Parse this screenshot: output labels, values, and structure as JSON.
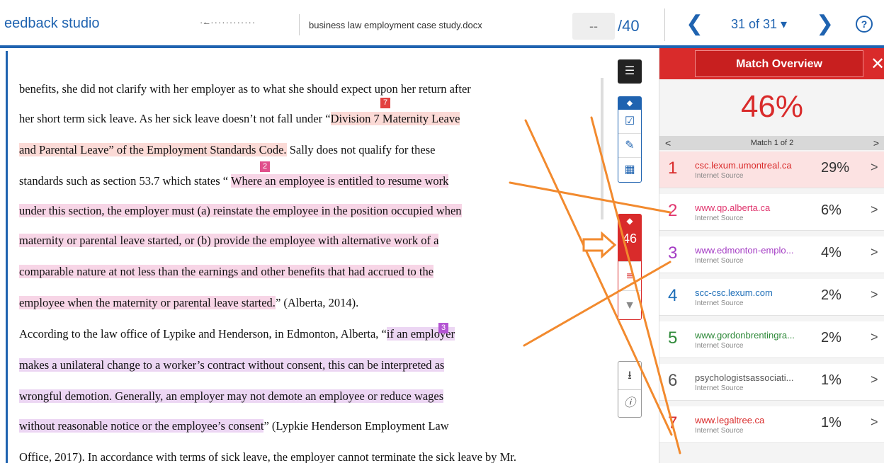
{
  "header": {
    "brand": "eedback studio",
    "student": "··̶ ············",
    "document": "business law employment case study.docx",
    "grade_value": "--",
    "grade_total": "/40",
    "paper_count": "31 of 31 ▾",
    "help": "?"
  },
  "doc": {
    "lines": [
      [
        {
          "t": "benefits, she did not clarify with her employer as to what she should expect upon her return after",
          "h": ""
        }
      ],
      [
        {
          "t": "her short term sick leave.  As her sick leave doesn’t not fall under “",
          "h": ""
        },
        {
          "t": "Division 7 Maternity Leave",
          "h": "red"
        }
      ],
      [
        {
          "t": "and Parental Leave” of  the Employment Standards Code.",
          "h": "red"
        },
        {
          "t": " Sally does not qualify for these",
          "h": ""
        }
      ],
      [
        {
          "t": "standards such as section 53.7 which states “ ",
          "h": ""
        },
        {
          "t": "Where an employee is entitled to resume work",
          "h": "pink"
        }
      ],
      [
        {
          "t": "under this section, the employer must (a) reinstate the employee in the position occupied when",
          "h": "pink"
        }
      ],
      [
        {
          "t": "maternity or parental leave started, or (b) provide the employee with alternative work of a",
          "h": "pink"
        }
      ],
      [
        {
          "t": "comparable nature at not less than the earnings and other benefits that had accrued to the",
          "h": "pink"
        }
      ],
      [
        {
          "t": "employee when the maternity or parental leave started.",
          "h": "pink"
        },
        {
          "t": "” (Alberta, 2014).",
          "h": ""
        }
      ],
      [
        {
          "t": "According to the law office of Lypike and Henderson, in Edmonton, Alberta, “",
          "h": ""
        },
        {
          "t": "if an employer",
          "h": "purple"
        }
      ],
      [
        {
          "t": "makes a unilateral change to a worker’s contract without consent, this can be interpreted as",
          "h": "purple"
        }
      ],
      [
        {
          "t": "wrongful demotion. Generally, an employer may not demote an employee or reduce wages",
          "h": "purple"
        }
      ],
      [
        {
          "t": "without reasonable notice or the employee’s consent",
          "h": "purple"
        },
        {
          "t": "” (Lypkie Henderson Employment Law",
          "h": ""
        }
      ],
      [
        {
          "t": "Office, 2017). In accordance with terms of sick leave, the employer cannot terminate the sick leave by Mr.",
          "h": ""
        }
      ]
    ],
    "badges": {
      "b7": "7",
      "b2": "2",
      "b3": "3"
    }
  },
  "tools": {
    "layers_icon": "layers-icon",
    "red_count": "46"
  },
  "panel": {
    "title": "Match Overview",
    "percent": "46%",
    "match_nav": "Match 1 of 2",
    "matches": [
      {
        "num": "1",
        "source": "csc.lexum.umontreal.ca",
        "type": "Internet Source",
        "pct": "29%",
        "color": "#d92b2b"
      },
      {
        "num": "2",
        "source": "www.qp.alberta.ca",
        "type": "Internet Source",
        "pct": "6%",
        "color": "#e0356e"
      },
      {
        "num": "3",
        "source": "www.edmonton-emplo...",
        "type": "Internet Source",
        "pct": "4%",
        "color": "#a43cc4"
      },
      {
        "num": "4",
        "source": "scc-csc.lexum.com",
        "type": "Internet Source",
        "pct": "2%",
        "color": "#1f6fb8"
      },
      {
        "num": "5",
        "source": "www.gordonbrentingra...",
        "type": "Internet Source",
        "pct": "2%",
        "color": "#2f8a3a"
      },
      {
        "num": "6",
        "source": "psychologistsassociati...",
        "type": "Internet Source",
        "pct": "1%",
        "color": "#555555"
      },
      {
        "num": "7",
        "source": "www.legaltree.ca",
        "type": "Internet Source",
        "pct": "1%",
        "color": "#d92b2b"
      }
    ]
  }
}
